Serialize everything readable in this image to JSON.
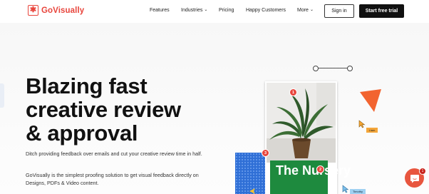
{
  "brand": {
    "name": "GoVisually",
    "accent": "#e8453c"
  },
  "nav": {
    "features": "Features",
    "industries": "Industries",
    "pricing": "Pricing",
    "happy_customers": "Happy Customers",
    "more": "More"
  },
  "header_actions": {
    "sign_in": "Sign in",
    "start_trial": "Start free trial"
  },
  "hero": {
    "title_lines": [
      "Blazing fast",
      "creative review",
      "& approval"
    ],
    "paragraph1": "Ditch providing feedback over emails and cut your creative review time in half.",
    "paragraph2": "GoVisually is the simplest proofing solution to get visual feedback directly on Designs, PDFs & Video content."
  },
  "illustration": {
    "card_text": "The Nursery",
    "pins": [
      "1",
      "2",
      "3"
    ],
    "cursor_tag_1": "Liam",
    "cursor_tag_2": "Timothy",
    "green": "#1e8a3e",
    "blue": "#2f6fd6",
    "triangle": "#f26430"
  },
  "chat": {
    "badge_count": "1",
    "color": "#e8563f"
  }
}
